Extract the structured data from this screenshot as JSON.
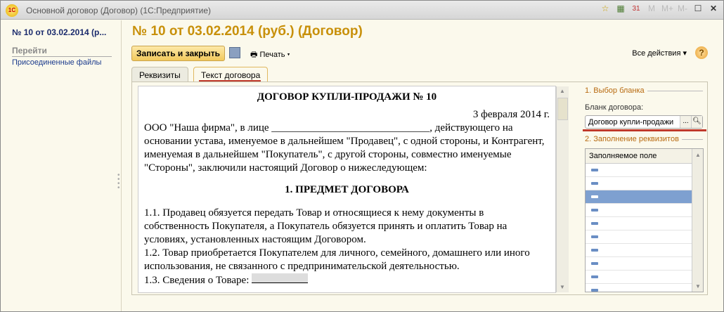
{
  "window": {
    "title": "Основной договор (Договор)  (1С:Предприятие)",
    "logo": "1С",
    "icons": [
      "favorites-icon",
      "calculator-icon",
      "calendar-icon",
      "M",
      "M+",
      "M-",
      "maximize-icon",
      "close-icon"
    ]
  },
  "left": {
    "title": "№ 10 от 03.02.2014 (р...",
    "goto": "Перейти",
    "link": "Присоединенные файлы"
  },
  "page": {
    "title": "№ 10 от 03.02.2014 (руб.) (Договор)"
  },
  "toolbar": {
    "save_close": "Записать и закрыть",
    "print": "Печать",
    "all_actions": "Все действия",
    "help": "?"
  },
  "tabs": [
    {
      "label": "Реквизиты"
    },
    {
      "label": "Текст договора",
      "active": true
    }
  ],
  "document": {
    "title": "ДОГОВОР КУПЛИ-ПРОДАЖИ № 10",
    "date": "3 февраля 2014 г.",
    "intro": "ООО \"Наша фирма\", в лице ______________________________, действующего на основании устава, именуемое в дальнейшем \"Продавец\", с одной стороны, и Контрагент, именуемая в дальнейшем \"Покупатель\", с другой стороны, совместно именуемые \"Стороны\", заключили настоящий Договор о нижеследующем:",
    "section1": "1. ПРЕДМЕТ ДОГОВОРА",
    "p1": "1.1. Продавец обязуется передать Товар и относящиеся к нему документы в собственность Покупателя, а Покупатель обязуется принять и оплатить Товар на условиях, установленных настоящим Договором.",
    "p2": "1.2. Товар приобретается Покупателем для личного, семейного, домашнего или иного использования, не связанного с предпринимательской деятельностью.",
    "p3": "1.3. Сведения о Товаре: "
  },
  "side": {
    "group1": "1. Выбор бланка",
    "field_label": "Бланк договора:",
    "field_value": "Договор купли-продажи",
    "choose": "...",
    "group2": "2. Заполнение реквизитов",
    "column": "Заполняемое поле",
    "selected_row": 3
  }
}
